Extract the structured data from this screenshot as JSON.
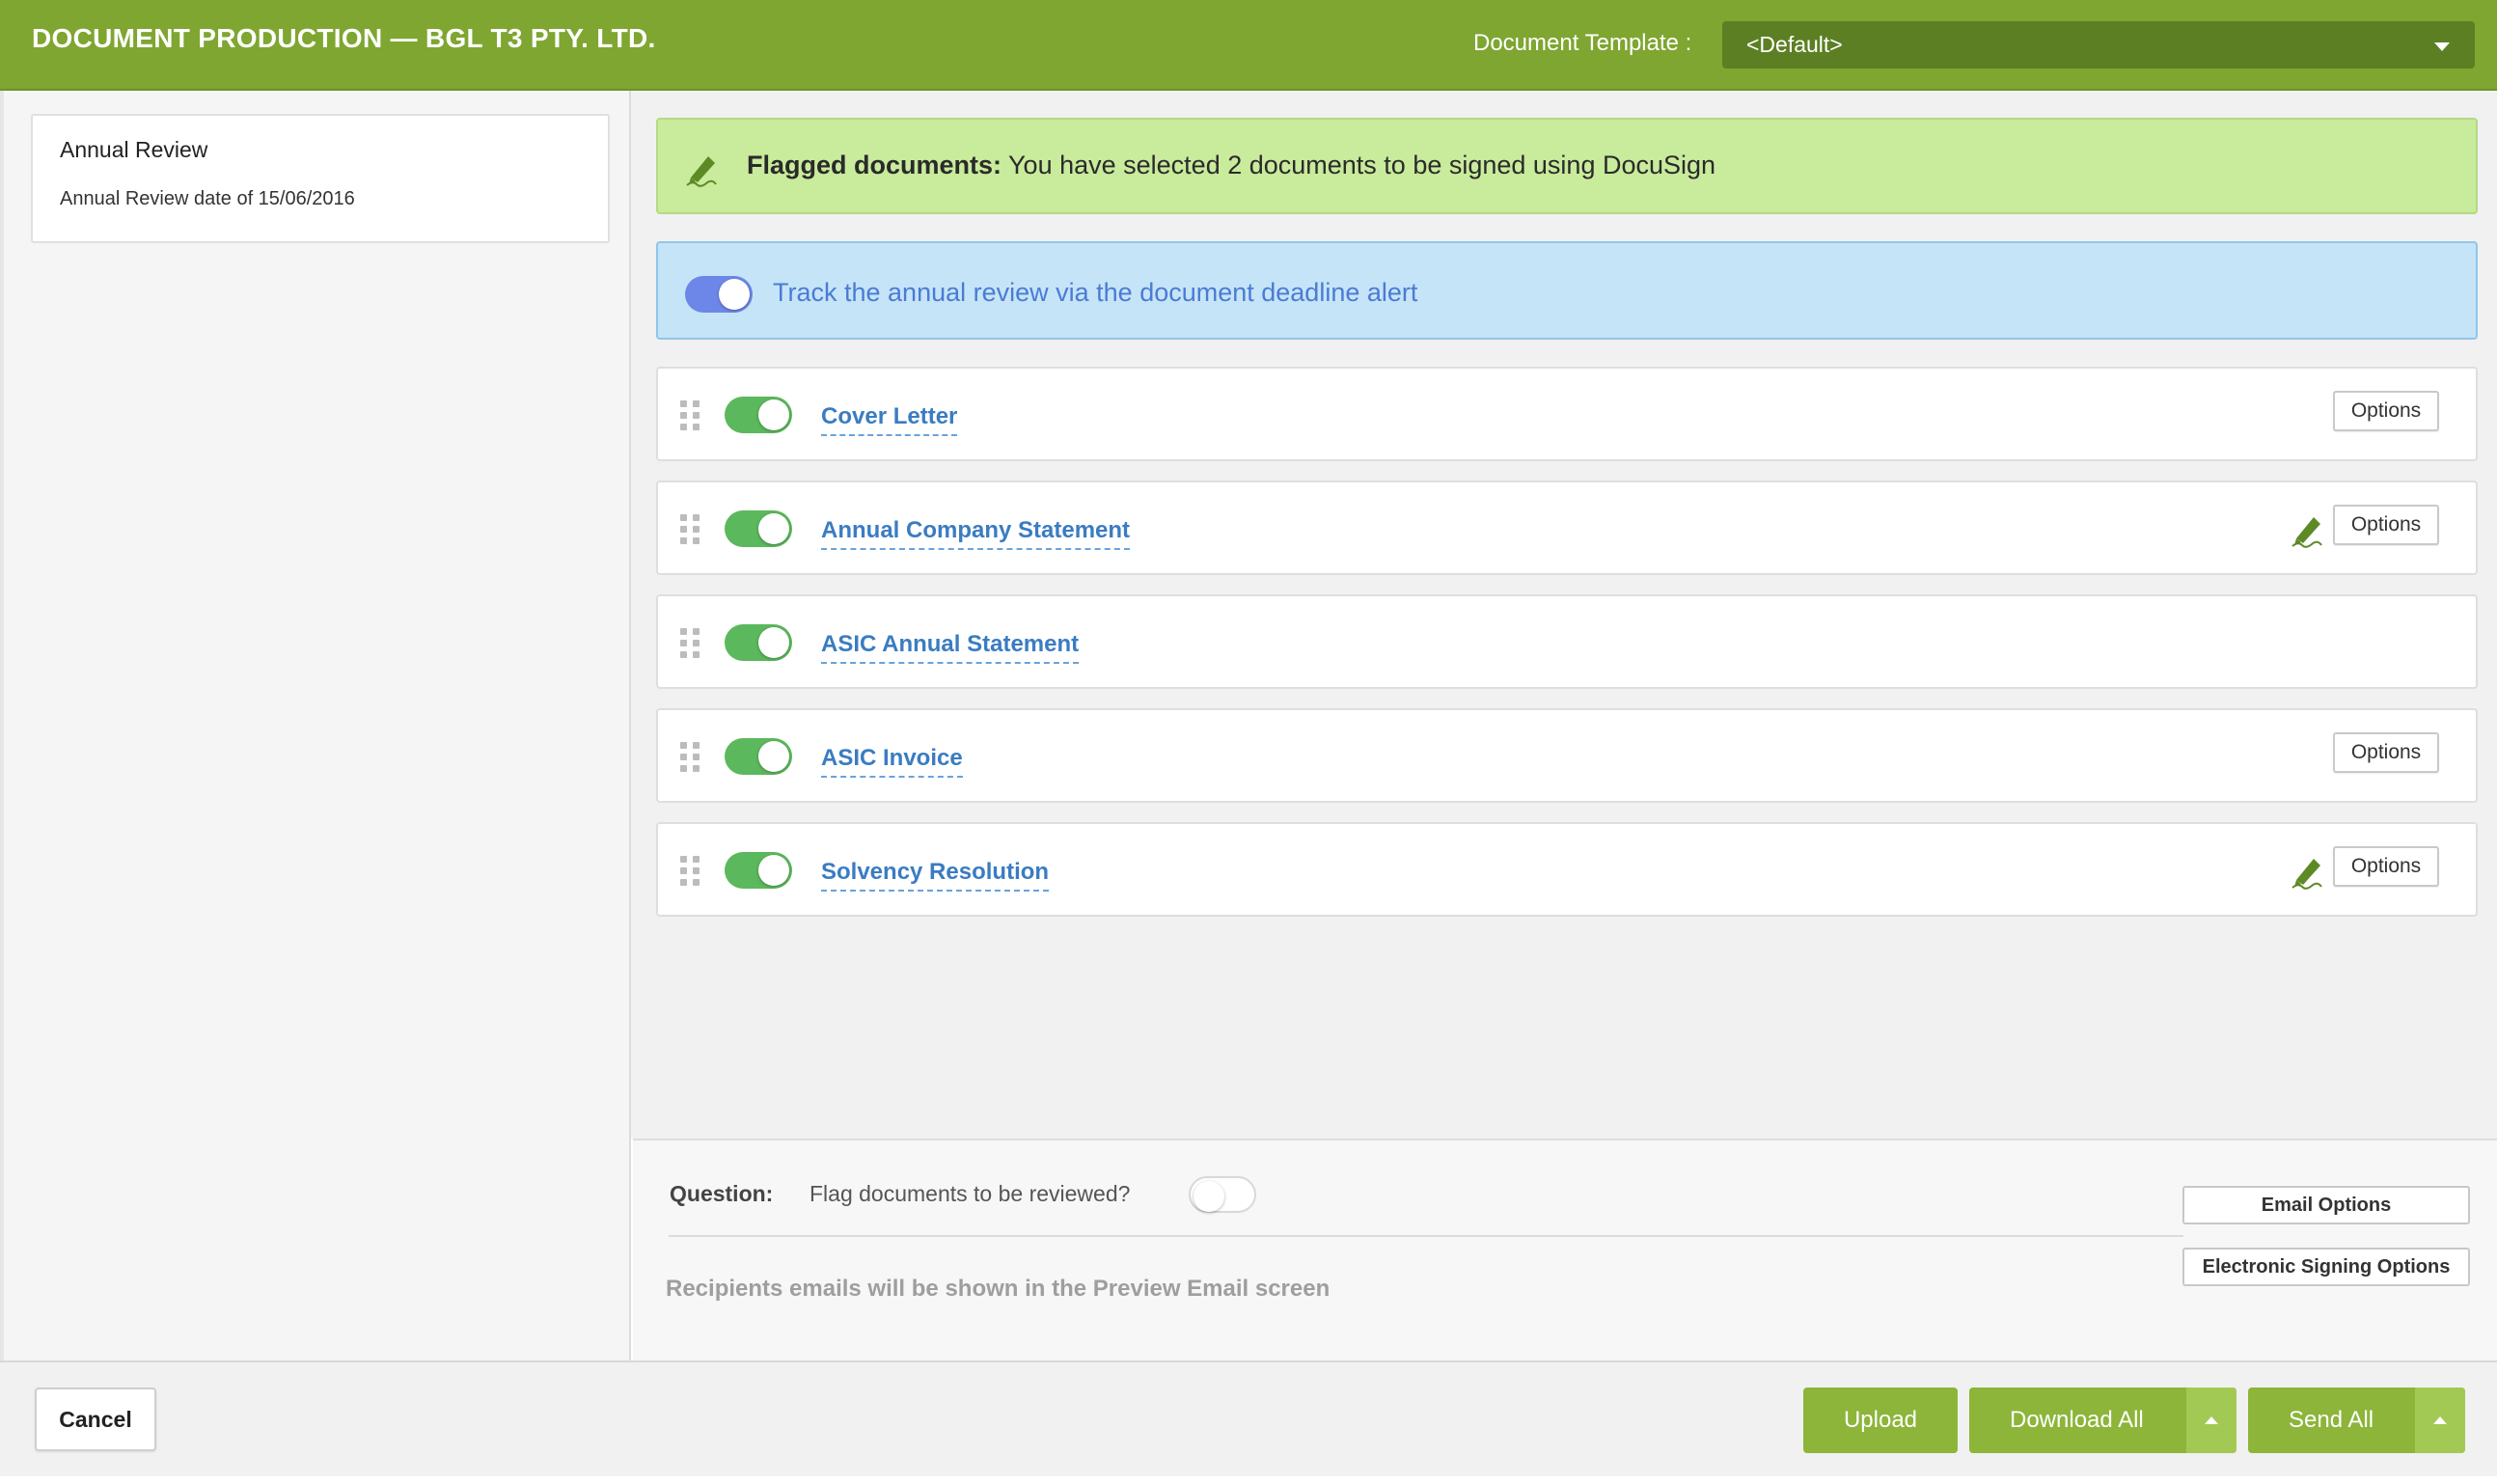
{
  "header": {
    "title": "DOCUMENT PRODUCTION — BGL T3 PTY. LTD.",
    "template_label": "Document Template :",
    "template_value": "<Default>"
  },
  "sidebar": {
    "card_title": "Annual Review",
    "card_subtitle": "Annual Review date of 15/06/2016"
  },
  "flag_banner": {
    "bold": "Flagged documents:",
    "text": " You have selected 2 documents to be signed using DocuSign"
  },
  "track_banner": {
    "text": "Track the annual review via the document deadline alert",
    "enabled": true
  },
  "documents": [
    {
      "name": "Cover Letter",
      "enabled": true,
      "signed": false,
      "options_label": "Options"
    },
    {
      "name": "Annual Company Statement",
      "enabled": true,
      "signed": true,
      "options_label": "Options"
    },
    {
      "name": "ASIC Annual Statement",
      "enabled": true,
      "signed": false,
      "options_label": ""
    },
    {
      "name": "ASIC Invoice",
      "enabled": true,
      "signed": false,
      "options_label": "Options"
    },
    {
      "name": "Solvency Resolution",
      "enabled": true,
      "signed": true,
      "options_label": "Options"
    }
  ],
  "question": {
    "label": "Question:",
    "text": "Flag documents to be reviewed?",
    "enabled": false,
    "recipients_note": "Recipients emails will be shown in the Preview Email screen"
  },
  "side_buttons": {
    "email_options": "Email Options",
    "signing_options": "Electronic Signing Options"
  },
  "footer": {
    "cancel": "Cancel",
    "upload": "Upload",
    "download_all": "Download All",
    "send_all": "Send All"
  },
  "colors": {
    "header_green": "#7ea631",
    "button_green": "#8cb53a",
    "link_blue": "#3a7cc2",
    "toggle_green": "#5cb85c",
    "toggle_blue": "#6d87e8"
  }
}
